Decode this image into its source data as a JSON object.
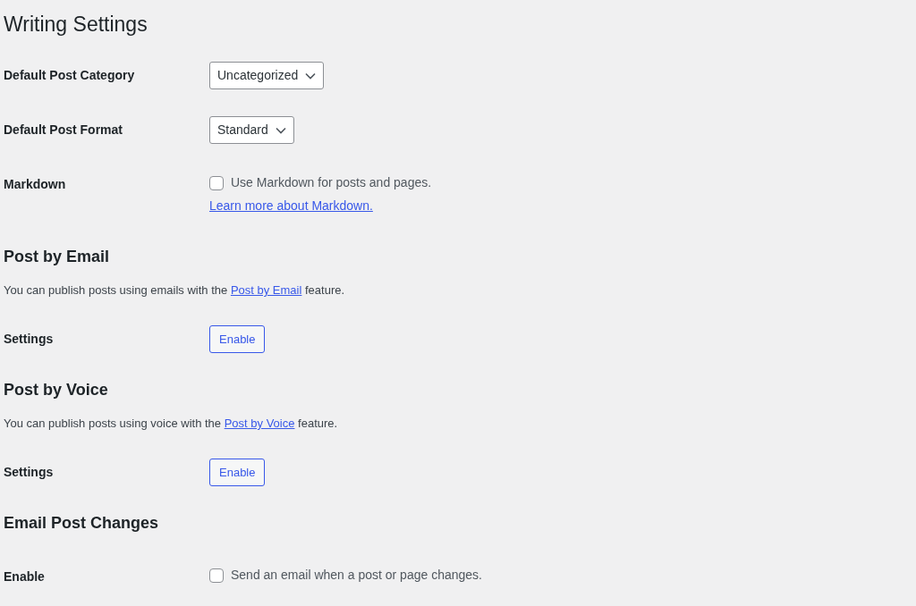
{
  "title": "Writing Settings",
  "sections": [
    {
      "rows": [
        {
          "label": "Default Post Category",
          "kind": "select",
          "value": "Uncategorized"
        },
        {
          "label": "Default Post Format",
          "kind": "select",
          "value": "Standard"
        },
        {
          "label": "Markdown",
          "kind": "checkbox",
          "checked": false,
          "text": "Use Markdown for posts and pages.",
          "link": "Learn more about Markdown."
        }
      ]
    },
    {
      "heading": "Post by Email",
      "description": {
        "before": "You can publish posts using emails with the ",
        "link": "Post by Email",
        "after": " feature."
      },
      "rows": [
        {
          "label": "Settings",
          "kind": "button",
          "text": "Enable"
        }
      ]
    },
    {
      "heading": "Post by Voice",
      "description": {
        "before": "You can publish posts using voice with the ",
        "link": "Post by Voice",
        "after": " feature."
      },
      "rows": [
        {
          "label": "Settings",
          "kind": "button",
          "text": "Enable"
        }
      ]
    },
    {
      "heading": "Email Post Changes",
      "rows": [
        {
          "label": "Enable",
          "kind": "checkbox",
          "checked": false,
          "text": "Send an email when a post or page changes."
        }
      ]
    }
  ]
}
